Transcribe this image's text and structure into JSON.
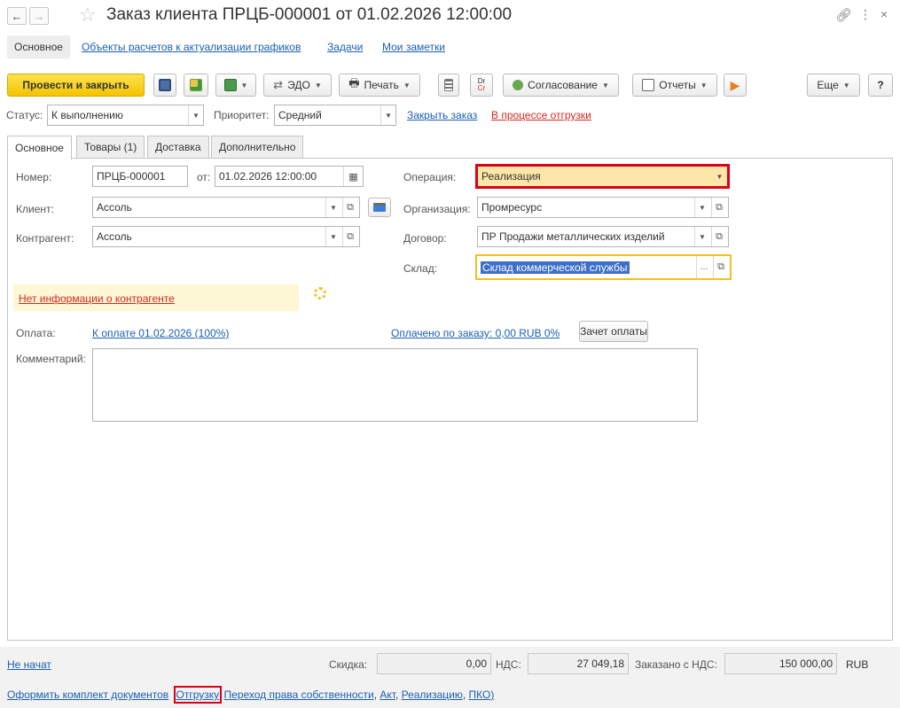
{
  "window": {
    "title": "Заказ клиента ПРЦБ-000001 от 01.02.2026 12:00:00"
  },
  "sections": [
    "Основное",
    "Объекты расчетов к актуализации графиков",
    "Задачи",
    "Мои заметки"
  ],
  "toolbar": {
    "post_close": "Провести и закрыть",
    "edo": "ЭДО",
    "print": "Печать",
    "approval": "Согласование",
    "reports": "Отчеты",
    "more": "Еще",
    "help": "?"
  },
  "status_row": {
    "status_label": "Статус:",
    "status_value": "К выполнению",
    "priority_label": "Приоритет:",
    "priority_value": "Средний",
    "close_order": "Закрыть заказ",
    "shipping_state": "В процессе отгрузки"
  },
  "tabs": [
    "Основное",
    "Товары (1)",
    "Доставка",
    "Дополнительно"
  ],
  "form": {
    "number_label": "Номер:",
    "number_value": "ПРЦБ-000001",
    "date_label": "от:",
    "date_value": "01.02.2026 12:00:00",
    "client_label": "Клиент:",
    "client_value": "Ассоль",
    "counterparty_label": "Контрагент:",
    "counterparty_value": "Ассоль",
    "operation_label": "Операция:",
    "operation_value": "Реализация",
    "organization_label": "Организация:",
    "organization_value": "Промресурс",
    "contract_label": "Договор:",
    "contract_value": "ПР Продажи металлических изделий",
    "warehouse_label": "Склад:",
    "warehouse_value": "Склад коммерческой службы",
    "no_info": "Нет информации о контрагенте",
    "payment_label": "Оплата:",
    "payment_link": "К оплате 01.02.2026 (100%)",
    "paid_link": "Оплачено по заказу: 0,00 RUB 0%",
    "offset_button": "Зачет оплаты",
    "comment_label": "Комментарий:"
  },
  "footer": {
    "not_started": "Не начат",
    "discount_label": "Скидка:",
    "discount_value": "0,00",
    "vat_label": "НДС:",
    "vat_value": "27 049,18",
    "ordered_label": "Заказано с НДС:",
    "ordered_value": "150 000,00",
    "currency": "RUB",
    "links": {
      "docs_set": "Оформить комплект документов",
      "shipment": "Отгрузку",
      "ownership": "Переход права собственности",
      "act": "Акт",
      "sale": "Реализацию",
      "pko": "ПКО)"
    }
  },
  "colors": {
    "accent_yellow": "#f5c400",
    "highlight_red": "#d8001a",
    "link_blue": "#1a5fb4",
    "warning_bg": "#fdf7d6"
  }
}
